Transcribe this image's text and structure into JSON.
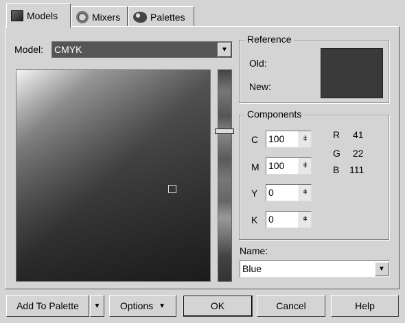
{
  "tabs": [
    {
      "label": "Models",
      "icon": "cube-icon",
      "active": true
    },
    {
      "label": "Mixers",
      "icon": "ring-icon",
      "active": false
    },
    {
      "label": "Palettes",
      "icon": "palette-icon",
      "active": false
    }
  ],
  "model": {
    "label": "Model:",
    "value": "CMYK"
  },
  "reference": {
    "title": "Reference",
    "old_label": "Old:",
    "new_label": "New:",
    "color": "#3a3a3a"
  },
  "components": {
    "title": "Components",
    "fields": [
      {
        "label": "C",
        "value": "100"
      },
      {
        "label": "M",
        "value": "100"
      },
      {
        "label": "Y",
        "value": "0"
      },
      {
        "label": "K",
        "value": "0"
      }
    ],
    "rgb": [
      {
        "label": "R",
        "value": "41"
      },
      {
        "label": "G",
        "value": "22"
      },
      {
        "label": "B",
        "value": "111"
      }
    ]
  },
  "name": {
    "label": "Name:",
    "value": "Blue"
  },
  "buttons": {
    "add_to_palette": "Add To Palette",
    "options": "Options",
    "ok": "OK",
    "cancel": "Cancel",
    "help": "Help"
  }
}
